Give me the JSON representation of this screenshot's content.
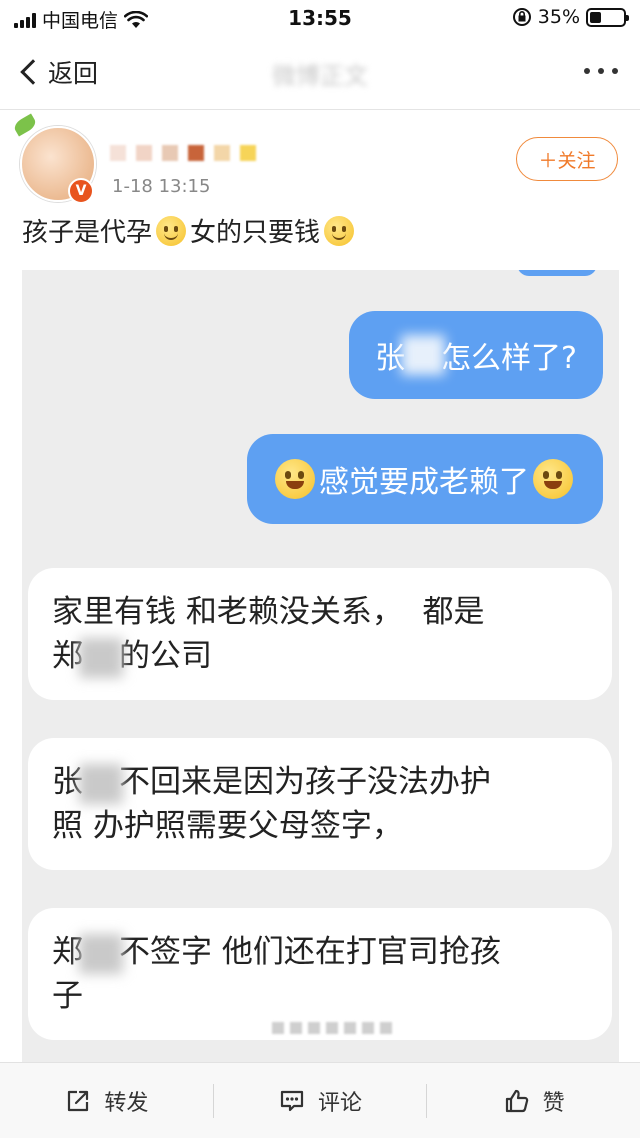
{
  "status_bar": {
    "carrier": "中国电信",
    "time": "13:55",
    "battery_percent": "35%",
    "battery_level": 0.35,
    "icons": [
      "signal-icon",
      "wifi-icon",
      "rotation-lock-icon",
      "battery-icon"
    ]
  },
  "nav": {
    "back_label": "返回",
    "title": "微博正文"
  },
  "post": {
    "time": "1-18 13:15",
    "follow_label": "＋关注",
    "text_part1": "孩子是代孕",
    "text_part2": "女的只要钱",
    "emoji": "smile-emoji"
  },
  "chat": {
    "msg1_a": "张",
    "msg1_b": "怎么样了?",
    "msg2": "感觉要成老赖了",
    "msg3_line1": "家里有钱 和老赖没关系，  都是",
    "msg3_line2_a": "郑",
    "msg3_line2_b": "的公司",
    "msg4_line1_a": "张",
    "msg4_line1_b": "不回来是因为孩子没法办护",
    "msg4_line2": "照 办护照需要父母签字，",
    "msg5_line1_a": "郑",
    "msg5_line1_b": "不签字 他们还在打官司抢孩",
    "msg5_line2": "子"
  },
  "toolbar": {
    "repost_label": "转发",
    "comment_label": "评论",
    "like_label": "赞"
  },
  "colors": {
    "bubble_blue": "#5ea0f2",
    "follow_orange": "#f07a2a",
    "verify_red": "#e8541e"
  }
}
